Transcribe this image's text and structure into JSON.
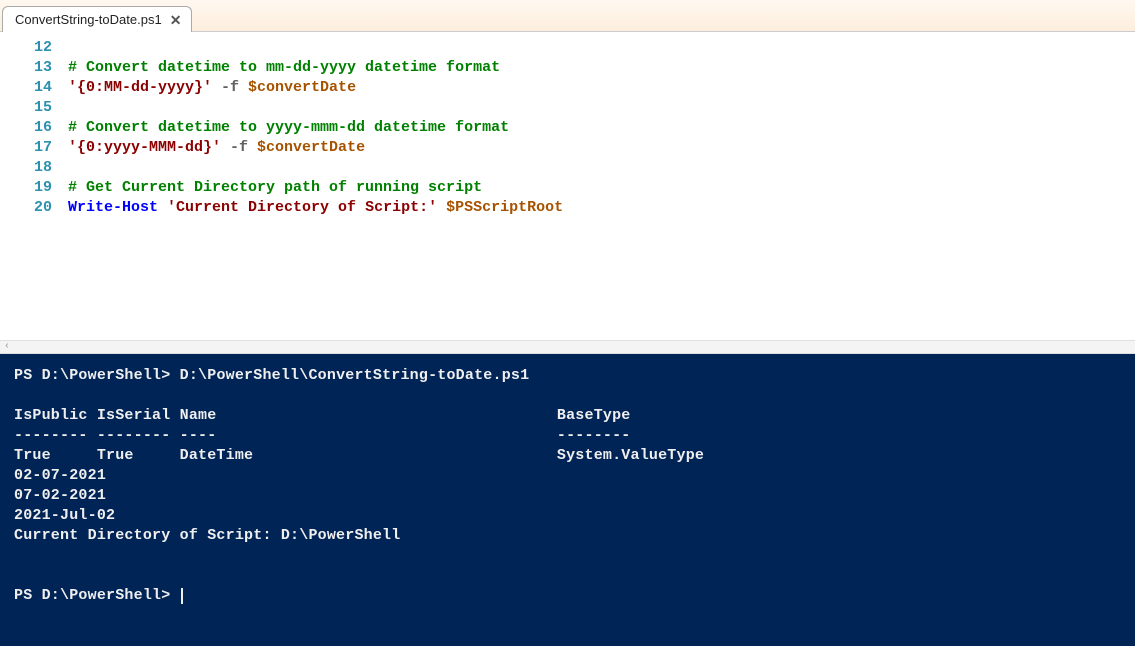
{
  "tab": {
    "title": "ConvertString-toDate.ps1",
    "close": "✕"
  },
  "editor": {
    "lines": {
      "l12": "12",
      "l13": "13",
      "l14": "14",
      "l15": "15",
      "l16": "16",
      "l17": "17",
      "l18": "18",
      "l19": "19",
      "l20": "20"
    },
    "code": {
      "c13": "# Convert datetime to mm-dd-yyyy datetime format",
      "s14": "'{0:MM-dd-yyyy}'",
      "op14": " -f ",
      "v14": "$convertDate",
      "c16": "# Convert datetime to yyyy-mmm-dd datetime format",
      "s17": "'{0:yyyy-MMM-dd}'",
      "op17": " -f ",
      "v17": "$convertDate",
      "c19": "# Get Current Directory path of running script",
      "cmd20": "Write-Host",
      "sp20": " ",
      "s20": "'Current Directory of Script:'",
      "sp20b": " ",
      "v20": "$PSScriptRoot"
    }
  },
  "scrollhint": "‹",
  "terminal": {
    "prompt1": "PS D:\\PowerShell> ",
    "cmd1": "D:\\PowerShell\\ConvertString-toDate.ps1",
    "blank1": "",
    "hdr": "IsPublic IsSerial Name                                     BaseType",
    "sep": "-------- -------- ----                                     --------",
    "row": "True     True     DateTime                                 System.ValueType",
    "o1": "02-07-2021",
    "o2": "07-02-2021",
    "o3": "2021-Jul-02",
    "o4": "Current Directory of Script: D:\\PowerShell",
    "blank2": "",
    "blank3": "",
    "prompt2": "PS D:\\PowerShell> "
  }
}
